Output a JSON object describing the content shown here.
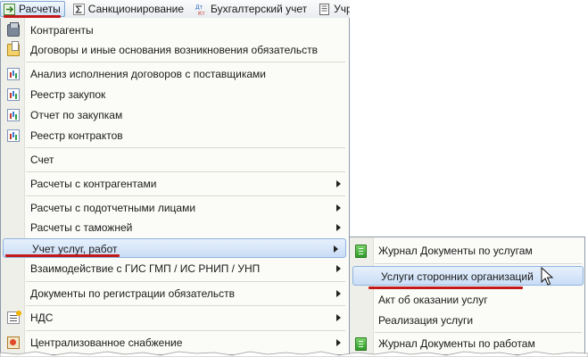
{
  "menubar": {
    "items": [
      {
        "label": "Расчеты",
        "icon": "raschety-icon",
        "active": true
      },
      {
        "label": "Санкционирование",
        "icon": "sigma-icon"
      },
      {
        "label": "Бухгалтерский учет",
        "icon": "debit-credit-icon"
      },
      {
        "label": "Учрежден",
        "icon": "institution-icon"
      }
    ]
  },
  "menu": {
    "items": [
      {
        "label": "Контрагенты",
        "icon": "contragents-icon"
      },
      {
        "label": "Договоры и иные основания возникновения обязательств",
        "icon": "contracts-folder-icon"
      },
      {
        "label": "Анализ исполнения договоров с поставщиками",
        "icon": "report-chart-icon"
      },
      {
        "label": "Реестр закупок",
        "icon": "report-chart-icon"
      },
      {
        "label": "Отчет по закупкам",
        "icon": "report-chart-icon"
      },
      {
        "label": "Реестр контрактов",
        "icon": "report-chart-icon"
      },
      {
        "label": "Счет"
      },
      {
        "label": "Расчеты с контрагентами",
        "submenu": true
      },
      {
        "label": "Расчеты с подотчетными лицами",
        "submenu": true
      },
      {
        "label": "Расчеты с таможней",
        "submenu": true
      },
      {
        "label": "Учет услуг, работ",
        "submenu": true,
        "highlighted": true
      },
      {
        "label": "Взаимодействие с ГИС ГМП / ИС РНИП / УНП",
        "submenu": true
      },
      {
        "label": "Документы по регистрации обязательств",
        "submenu": true
      },
      {
        "label": "НДС",
        "submenu": true,
        "icon": "nds-icon"
      },
      {
        "label": "Централизованное снабжение",
        "submenu": true,
        "icon": "supply-icon"
      }
    ]
  },
  "submenu": {
    "items": [
      {
        "label": "Журнал Документы по услугам",
        "icon": "journal-icon"
      },
      {
        "label": "Услуги сторонних организаций",
        "highlighted": true
      },
      {
        "label": "Акт об оказании услуг"
      },
      {
        "label": "Реализация услуги"
      },
      {
        "label": "Журнал Документы по работам",
        "icon": "journal-icon"
      }
    ]
  },
  "colors": {
    "accent_underline": "#c21a1a",
    "highlight": "#c9ddf6"
  }
}
